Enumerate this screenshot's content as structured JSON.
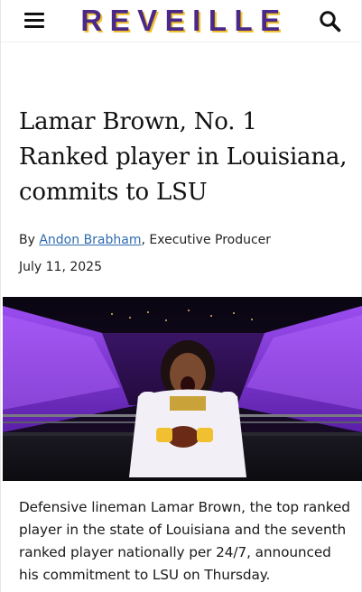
{
  "header": {
    "logo_text": "REVEILLE",
    "menu_icon": "hamburger-menu-icon",
    "search_icon": "search-icon",
    "brand_purple": "#4a2a86",
    "brand_gold": "#f2c12e"
  },
  "article": {
    "headline": "Lamar Brown, No. 1 Ranked player in Louisiana, commits to LSU",
    "byline_prefix": "By",
    "author": "Andon Brabham",
    "author_role": ", Executive Producer",
    "date": "July 11, 2025",
    "lead_paragraph": "Defensive lineman Lamar Brown, the top ranked player in the state of Louisiana and the seventh ranked player nationally per 24/7, announced his commitment to LSU on Thursday."
  }
}
